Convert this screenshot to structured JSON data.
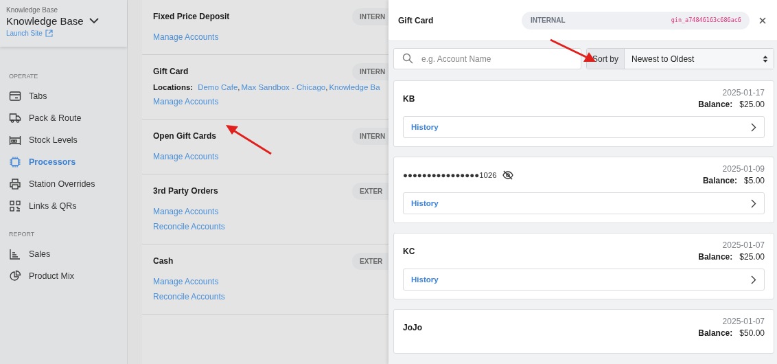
{
  "sidebar": {
    "site_caption": "Knowledge Base",
    "site_name": "Knowledge Base",
    "launch_link": "Launch Site",
    "sections": [
      {
        "heading": "OPERATE",
        "items": [
          {
            "label": "Tabs",
            "kind": "tabs",
            "selected": false
          },
          {
            "label": "Pack & Route",
            "kind": "truck",
            "selected": false
          },
          {
            "label": "Stock Levels",
            "kind": "stock",
            "selected": false
          },
          {
            "label": "Processors",
            "kind": "chip",
            "selected": true
          },
          {
            "label": "Station Overrides",
            "kind": "printer",
            "selected": false
          },
          {
            "label": "Links & QRs",
            "kind": "qr",
            "selected": false
          }
        ]
      },
      {
        "heading": "REPORT",
        "items": [
          {
            "label": "Sales",
            "kind": "chart",
            "selected": false
          },
          {
            "label": "Product Mix",
            "kind": "pie",
            "selected": false
          }
        ]
      }
    ]
  },
  "processors": [
    {
      "title": "Fixed Price Deposit",
      "badge": "INTERN",
      "links": [
        "Manage Accounts"
      ]
    },
    {
      "title": "Gift Card",
      "badge": "INTERN",
      "locations_label": "Locations:",
      "locations": [
        "Demo Cafe",
        "Max Sandbox - Chicago",
        "Knowledge Ba"
      ],
      "separator": ",",
      "links": [
        "Manage Accounts"
      ]
    },
    {
      "title": "Open Gift Cards",
      "badge": "INTERN",
      "links": [
        "Manage Accounts"
      ]
    },
    {
      "title": "3rd Party Orders",
      "badge": "EXTER",
      "links": [
        "Manage Accounts",
        "Reconcile Accounts"
      ]
    },
    {
      "title": "Cash",
      "badge": "EXTER",
      "links": [
        "Manage Accounts",
        "Reconcile Accounts"
      ]
    }
  ],
  "drawer": {
    "title": "Gift Card",
    "type": "INTERNAL",
    "id": "gin_a74846163c686ac6",
    "search": {
      "placeholder": "e.g. Account Name"
    },
    "sort_label": "Sort by",
    "sort_value": "Newest to Oldest",
    "accounts": [
      {
        "name": "KB",
        "masked": false,
        "date": "2025-01-17",
        "balance_label": "Balance:",
        "balance": "$25.00",
        "history": "History"
      },
      {
        "name": "●●●●●●●●●●●●●●●●1026",
        "masked": true,
        "date": "2025-01-09",
        "balance_label": "Balance:",
        "balance": "$5.00",
        "history": "History"
      },
      {
        "name": "KC",
        "masked": false,
        "date": "2025-01-07",
        "balance_label": "Balance:",
        "balance": "$25.00",
        "history": "History"
      },
      {
        "name": "JoJo",
        "masked": false,
        "date": "2025-01-07",
        "balance_label": "Balance:",
        "balance": "$50.00"
      }
    ]
  }
}
